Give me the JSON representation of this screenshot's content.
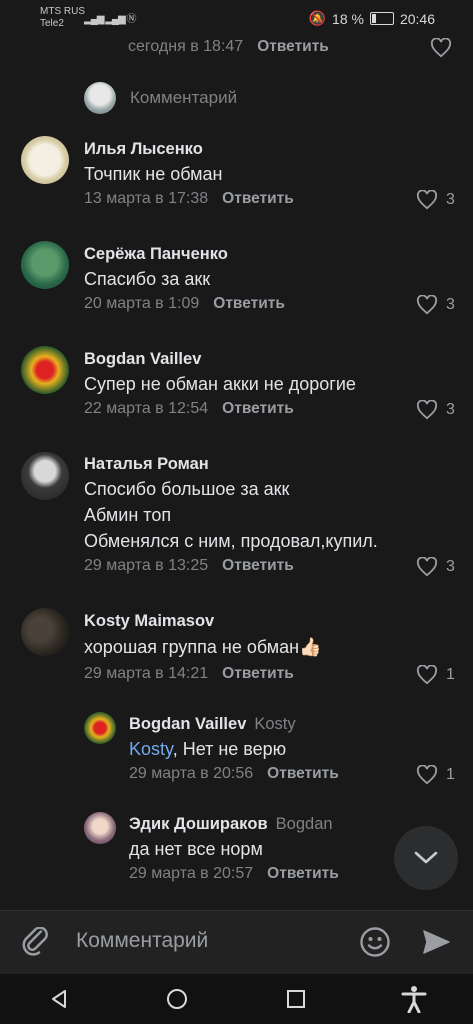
{
  "status_bar": {
    "carrier1": "MTS RUS",
    "carrier2": "Tele2",
    "battery": "18 %",
    "time": "20:46"
  },
  "top_comment": {
    "time": "сегодня в 18:47",
    "reply_label": "Ответить"
  },
  "comment_prompt": {
    "label": "Комментарий"
  },
  "comments": [
    {
      "name": "Илья Лысенко",
      "text": "Точпик не обман",
      "time": "13 марта в 17:38",
      "reply_label": "Ответить",
      "likes": "3"
    },
    {
      "name": "Серёжа Панченко",
      "text": "Спасибо за акк",
      "time": "20 марта в 1:09",
      "reply_label": "Ответить",
      "likes": "3"
    },
    {
      "name": "Bogdan Vaillev",
      "text": "Супер не обман акки не дорогие",
      "time": "22 марта в 12:54",
      "reply_label": "Ответить",
      "likes": "3"
    },
    {
      "name": "Наталья Роман",
      "text_lines": [
        "Спосибо большое за акк",
        "Абмин топ",
        "Обменялся с ним, продовал,купил."
      ],
      "time": "29 марта в 13:25",
      "reply_label": "Ответить",
      "likes": "3"
    },
    {
      "name": "Kosty Maimasov",
      "text": "хорошая группа не обман",
      "emoji": "👍🏻",
      "time": "29 марта в 14:21",
      "reply_label": "Ответить",
      "likes": "1"
    }
  ],
  "replies": [
    {
      "name": "Bogdan Vaillev",
      "reply_to": "Kosty",
      "mention": "Kosty",
      "text": ", Нет не верю",
      "time": "29 марта в 20:56",
      "reply_label": "Ответить",
      "likes": "1"
    },
    {
      "name": "Эдик Доширакoв",
      "reply_to": "Bogdan",
      "text": "да нет все норм",
      "time": "29 марта в 20:57",
      "reply_label": "Ответить"
    }
  ],
  "input": {
    "placeholder": "Комментарий"
  },
  "icons": [
    "attach-icon",
    "emoji-icon",
    "send-icon",
    "back-icon",
    "home-icon",
    "recents-icon",
    "accessibility-icon",
    "chevron-down-icon",
    "heart-icon"
  ]
}
